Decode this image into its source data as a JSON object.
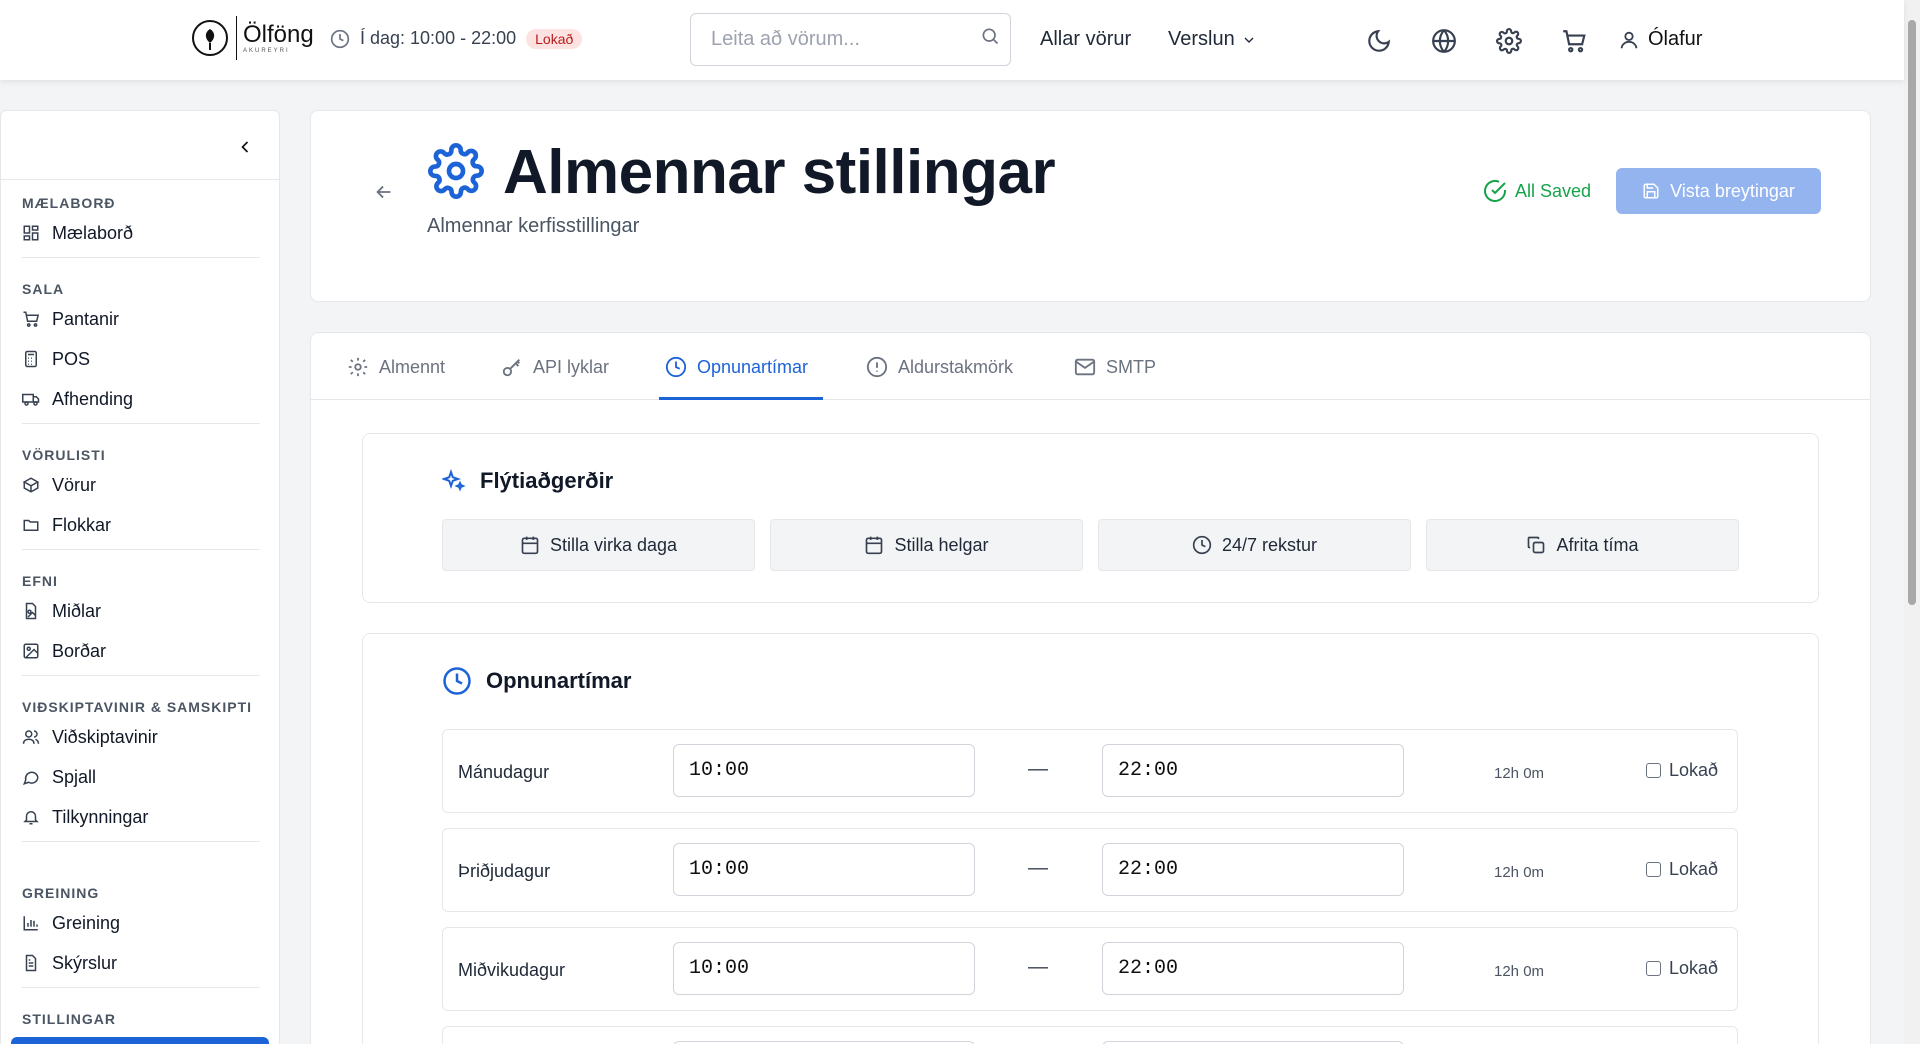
{
  "header": {
    "logo_text": "Ölföng",
    "logo_subtext": "AKUREYRI",
    "hours_label": "Í dag: 10:00 - 22:00",
    "status_badge": "Lokað",
    "search_placeholder": "Leita að vörum...",
    "nav_all_products": "Allar vörur",
    "nav_store": "Verslun",
    "user_name": "Ólafur",
    "icons": [
      "moon-icon",
      "globe-icon",
      "gear-icon",
      "cart-icon",
      "user-icon"
    ]
  },
  "sidebar": {
    "groups": [
      {
        "title": "MÆLABORÐ",
        "items": [
          {
            "label": "Mælaborð",
            "icon": "dashboard-icon"
          }
        ]
      },
      {
        "title": "SALA",
        "items": [
          {
            "label": "Pantanir",
            "icon": "cart-icon"
          },
          {
            "label": "POS",
            "icon": "calculator-icon"
          },
          {
            "label": "Afhending",
            "icon": "truck-icon"
          }
        ]
      },
      {
        "title": "VÖRULISTI",
        "items": [
          {
            "label": "Vörur",
            "icon": "box-icon"
          },
          {
            "label": "Flokkar",
            "icon": "folder-icon"
          }
        ]
      },
      {
        "title": "EFNI",
        "items": [
          {
            "label": "Miðlar",
            "icon": "file-image-icon"
          },
          {
            "label": "Borðar",
            "icon": "image-icon"
          }
        ]
      },
      {
        "title": "VIÐSKIPTAVINIR & SAMSKIPTI",
        "items": [
          {
            "label": "Viðskiptavinir",
            "icon": "users-icon"
          },
          {
            "label": "Spjall",
            "icon": "chat-icon"
          },
          {
            "label": "Tilkynningar",
            "icon": "bell-icon"
          }
        ]
      },
      {
        "title": "GREINING",
        "items": [
          {
            "label": "Greining",
            "icon": "bar-chart-icon"
          },
          {
            "label": "Skýrslur",
            "icon": "report-icon"
          }
        ]
      },
      {
        "title": "STILLINGAR",
        "items": []
      }
    ]
  },
  "page": {
    "title": "Almennar stillingar",
    "subtitle": "Almennar kerfisstillingar",
    "saved_status": "All Saved",
    "save_button": "Vista breytingar"
  },
  "tabs": [
    {
      "label": "Almennt",
      "icon": "gear-icon",
      "active": false
    },
    {
      "label": "API lyklar",
      "icon": "key-icon",
      "active": false
    },
    {
      "label": "Opnunartímar",
      "icon": "clock-icon",
      "active": true
    },
    {
      "label": "Aldurstakmörk",
      "icon": "alert-circle-icon",
      "active": false
    },
    {
      "label": "SMTP",
      "icon": "mail-icon",
      "active": false
    }
  ],
  "quick_actions": {
    "title": "Flýtiaðgerðir",
    "buttons": [
      {
        "label": "Stilla virka daga",
        "icon": "calendar-icon"
      },
      {
        "label": "Stilla helgar",
        "icon": "calendar-icon"
      },
      {
        "label": "24/7 rekstur",
        "icon": "clock-icon"
      },
      {
        "label": "Afrita tíma",
        "icon": "copy-icon"
      }
    ]
  },
  "opening_hours": {
    "title": "Opnunartímar",
    "separator": "—",
    "closed_label": "Lokað",
    "days": [
      {
        "name": "Mánudagur",
        "open": "10:00",
        "close": "22:00",
        "duration": "12h 0m",
        "closed": false
      },
      {
        "name": "Þriðjudagur",
        "open": "10:00",
        "close": "22:00",
        "duration": "12h 0m",
        "closed": false
      },
      {
        "name": "Miðvikudagur",
        "open": "10:00",
        "close": "22:00",
        "duration": "12h 0m",
        "closed": false
      }
    ]
  },
  "colors": {
    "accent": "#1d63d8",
    "success": "#16a34a",
    "danger_bg": "#fde2e2",
    "danger_text": "#b91c1c"
  }
}
